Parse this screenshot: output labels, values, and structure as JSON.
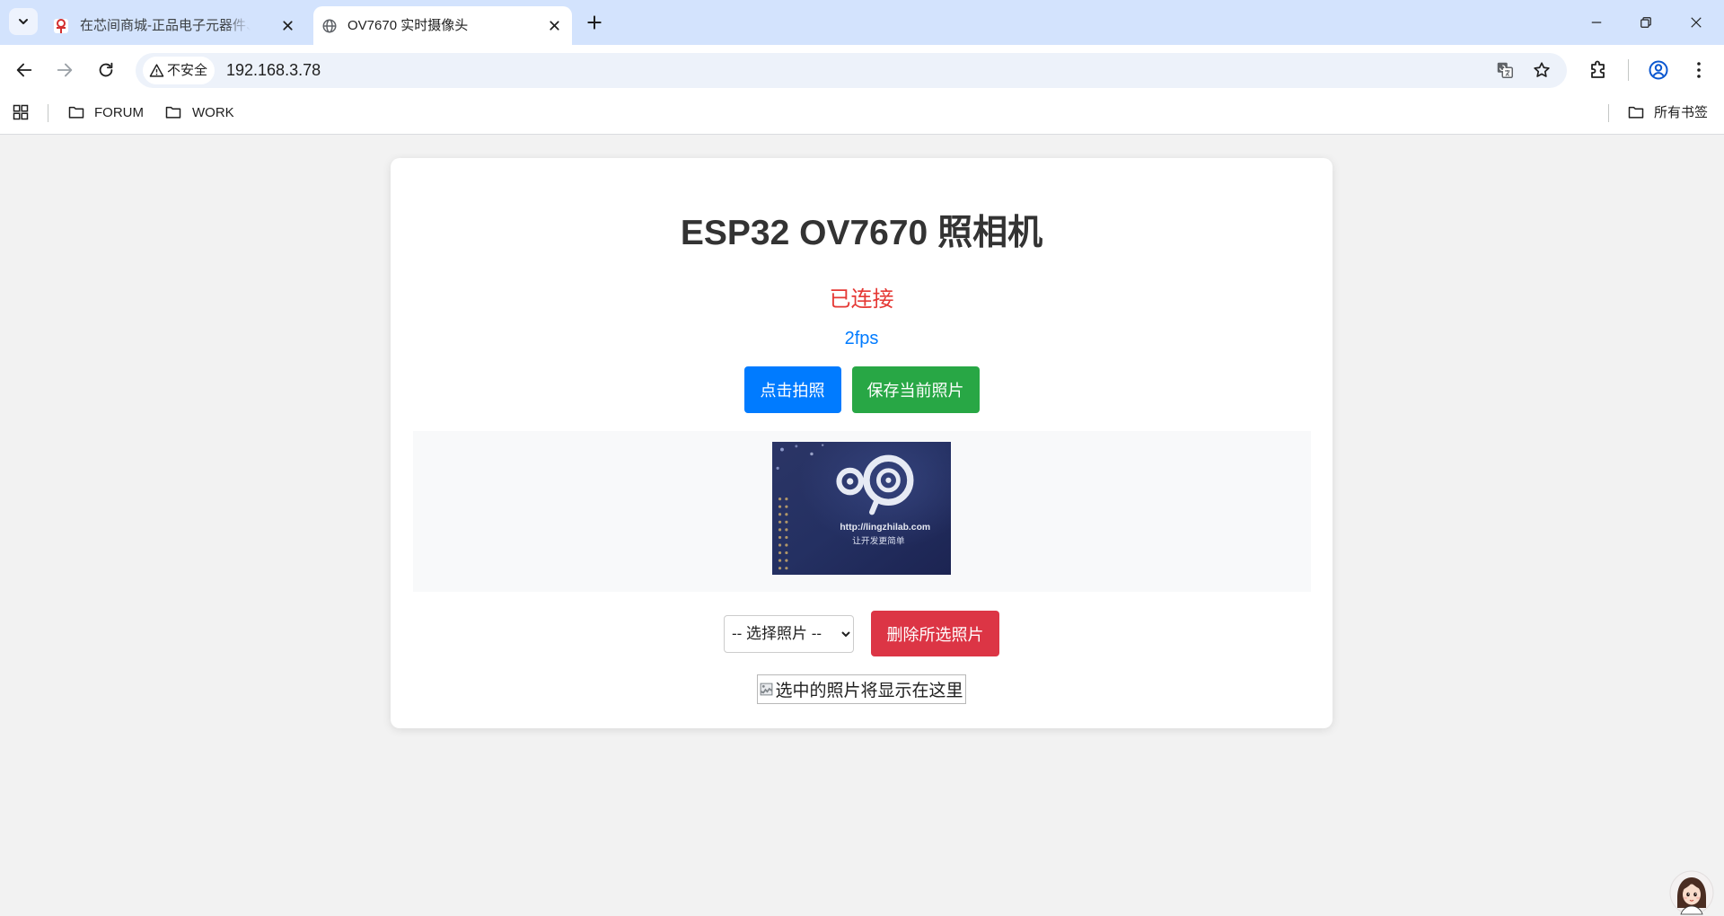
{
  "browser": {
    "tabs": [
      {
        "title": "在芯间商城-正品电子元器件、S",
        "active": false,
        "favicon": "store-logo-icon"
      },
      {
        "title": "OV7670 实时摄像头",
        "active": true,
        "favicon": "globe-icon"
      }
    ],
    "address_bar": {
      "security_label": "不安全",
      "url": "192.168.3.78"
    },
    "bookmarks": [
      {
        "label": "FORUM",
        "icon": "folder-icon"
      },
      {
        "label": "WORK",
        "icon": "folder-icon"
      }
    ],
    "all_bookmarks_label": "所有书签"
  },
  "page": {
    "title": "ESP32 OV7670 照相机",
    "connection_status": "已连接",
    "frame_rate": "2fps",
    "capture_button_label": "点击拍照",
    "save_button_label": "保存当前照片",
    "photo_select": {
      "selected_option": "-- 选择照片 --"
    },
    "delete_button_label": "删除所选照片",
    "preview_alt_text": "选中的照片将显示在这里",
    "live_frame_logo_text": [
      "http://lingzhilab.com",
      "让开发更简单"
    ]
  },
  "icons": {
    "tab_strip": [
      "tab-search-chevron-icon",
      "store-logo-icon",
      "globe-icon",
      "close-icon",
      "plus-icon"
    ],
    "window": [
      "minimize-icon",
      "restore-icon",
      "close-icon"
    ],
    "toolbar": [
      "back-arrow-icon",
      "forward-arrow-icon",
      "reload-icon",
      "warning-icon",
      "translate-icon",
      "star-icon",
      "extensions-icon",
      "profile-icon",
      "more-menu-icon"
    ],
    "bookmarks": [
      "apps-grid-icon",
      "folder-icon"
    ],
    "page": [
      "broken-image-icon",
      "assistant-avatar"
    ]
  },
  "colors": {
    "tab_strip": "#d3e3fd",
    "page_background": "#f2f2f2",
    "status_connected": "#e53935",
    "fps_text": "#007bff",
    "capture_button": "#007bff",
    "save_button": "#28a745",
    "delete_button": "#dc3545"
  }
}
